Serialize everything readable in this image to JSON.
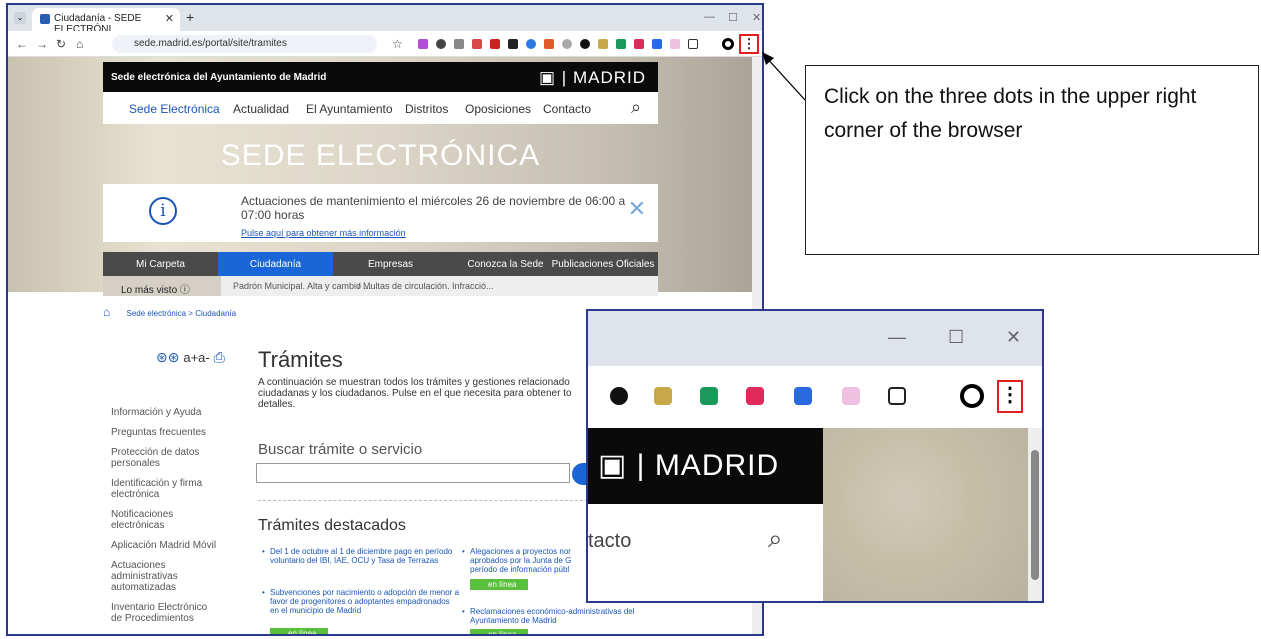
{
  "browser": {
    "tab_title": "Ciudadanía - SEDE ELECTRÓNI",
    "url": "sede.madrid.es/portal/site/tramites",
    "menu_dots": "⋮"
  },
  "header": {
    "site_name": "Sede electrónica del Ayuntamiento de Madrid",
    "logo_text": "MADRID",
    "nav": [
      "Sede Electrónica",
      "Actualidad",
      "El Ayuntamiento",
      "Distritos",
      "Oposiciones",
      "Contacto"
    ],
    "hero_title": "SEDE ELECTRÓNICA"
  },
  "notice": {
    "text": "Actuaciones de mantenimiento el miércoles 26 de noviembre de 06:00 a 07:00 horas",
    "link": "Pulse aquí para obtener más información"
  },
  "mainnav": [
    "Mi Carpeta",
    "Ciudadanía",
    "Empresas",
    "Conozca la Sede",
    "Publicaciones Oficiales"
  ],
  "mostseen": {
    "label": "Lo más visto",
    "items": [
      "Padrón Municipal. Alta y cambio ...",
      "/ Multas de circulación. Infracció..."
    ]
  },
  "breadcrumb": "Sede electrónica > Ciudadanía",
  "tools_text": "a+a-",
  "sidebar": [
    "Información y Ayuda",
    "Preguntas frecuentes",
    "Protección de datos personales",
    "Identificación y firma electrónica",
    "Notificaciones electrónicas",
    "Aplicación Madrid Móvil",
    "Actuaciones administrativas automatizadas",
    "Inventario Electrónico de Procedimientos"
  ],
  "main": {
    "title": "Trámites",
    "intro": "A continuación se muestran todos los trámites y gestiones relacionado ciudadanas y los ciudadanos. Pulse en el que necesita para obtener to detalles.",
    "search_label": "Buscar trámite o servicio",
    "featured_title": "Trámites destacados",
    "featured_left": [
      "Del 1 de octubre al 1 de diciembre pago en período voluntario del IBI, IAE, OCU y Tasa de Terrazas",
      "Subvenciones por nacimiento o adopción de menor a favor de progenitores o adoptantes empadronados en el municipio de Madrid"
    ],
    "featured_right": [
      "Alegaciones a proyectos nor aprobados por la Junta de G período de información públ",
      "Reclamaciones económico-administrativas del Ayuntamiento de Madrid"
    ],
    "online_label": "en línea"
  },
  "zoom": {
    "logo_text": "MADRID",
    "contact_partial": "tacto",
    "menu_dots": "⋮"
  },
  "callout": {
    "text": "Click on the three dots in the upper right corner of the browser"
  },
  "colors": {
    "accent_blue": "#1a66d6",
    "highlight_red": "#e02020",
    "frame_navy": "#2a3a8a",
    "online_green": "#58c03c"
  }
}
